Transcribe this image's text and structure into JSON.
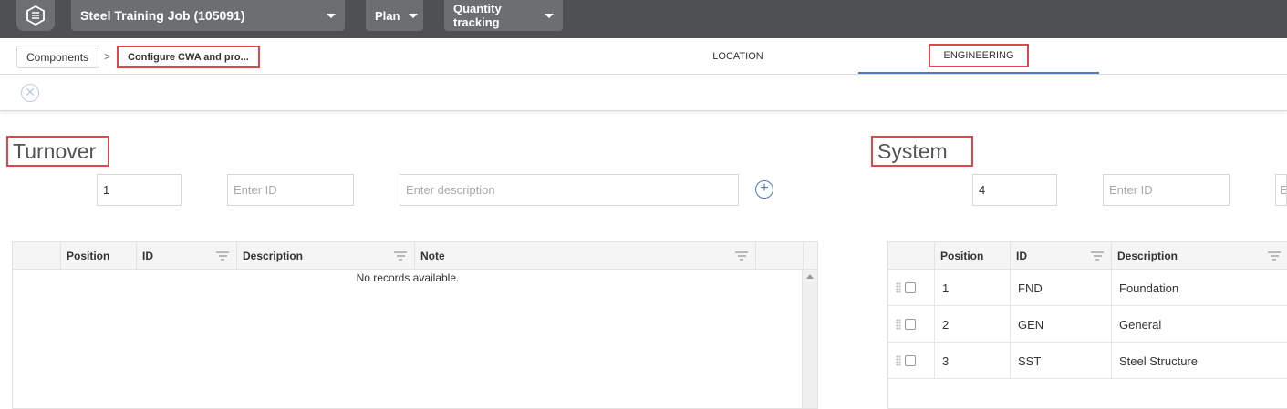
{
  "header": {
    "job_title": "Steel Training Job (105091)",
    "plan_label": "Plan",
    "quantity_tracking_label": "Quantity tracking"
  },
  "breadcrumb": {
    "components": "Components",
    "separator": ">",
    "current": "Configure CWA and pro..."
  },
  "tabs": {
    "location": "LOCATION",
    "engineering": "ENGINEERING"
  },
  "toolbar": {
    "cancel_symbol": "✕"
  },
  "turnover": {
    "title": "Turnover",
    "position_value": "1",
    "id_placeholder": "Enter ID",
    "description_placeholder": "Enter description",
    "add_symbol": "+",
    "columns": [
      "Position",
      "ID",
      "Description",
      "Note"
    ],
    "empty_text": "No records available."
  },
  "system": {
    "title": "System",
    "position_value": "4",
    "id_placeholder": "Enter ID",
    "description_placeholder": "Enter description",
    "columns": [
      "Position",
      "ID",
      "Description"
    ],
    "rows": [
      {
        "position": "1",
        "id": "FND",
        "description": "Foundation"
      },
      {
        "position": "2",
        "id": "GEN",
        "description": "General"
      },
      {
        "position": "3",
        "id": "SST",
        "description": "Steel Structure"
      }
    ]
  },
  "colors": {
    "topbar": "#4d5153",
    "highlight": "#e0474c",
    "accent": "#4a7cc2"
  }
}
